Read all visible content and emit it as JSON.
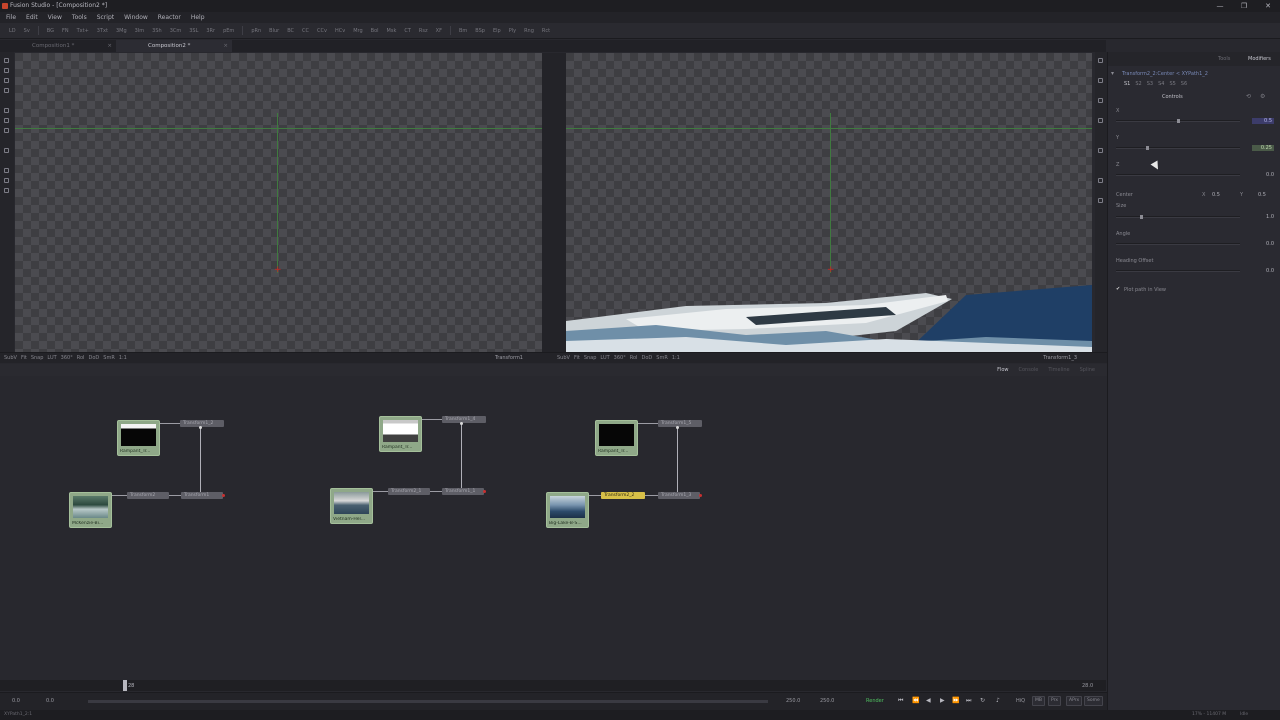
{
  "window": {
    "title": "Fusion Studio - [Composition2 *]",
    "controls": [
      "—",
      "❐",
      "✕"
    ]
  },
  "menu": [
    "File",
    "Edit",
    "View",
    "Tools",
    "Script",
    "Window",
    "Reactor",
    "Help"
  ],
  "toolbar": [
    "LD",
    "Sv",
    "BG",
    "FN",
    "Txt+",
    "3Txt",
    "3Mg",
    "3Im",
    "3Sh",
    "3Cm",
    "3SL",
    "3Rr",
    "pEm",
    "pRn",
    "Blur",
    "BC",
    "CC",
    "CCv",
    "HCv",
    "Mrg",
    "Bol",
    "Msk",
    "CT",
    "Rsz",
    "XF",
    "Bm",
    "BSp",
    "Elp",
    "Ply",
    "Rng",
    "Rct"
  ],
  "doc_tabs": [
    {
      "label": "Composition1 *",
      "active": false
    },
    {
      "label": "Composition2 *",
      "active": true
    }
  ],
  "viewers": {
    "left": {
      "bar": [
        "SubV",
        "Fit",
        "Snap",
        "LUT",
        "360°",
        "RoI",
        "DoD",
        "SmR",
        "1:1"
      ],
      "name": "Transform1"
    },
    "right": {
      "bar": [
        "SubV",
        "Fit",
        "Snap",
        "LUT",
        "360°",
        "RoI",
        "DoD",
        "SmR",
        "1:1"
      ],
      "name": "Transform1_3"
    }
  },
  "flow_tabs": [
    {
      "label": "Flow",
      "active": true
    },
    {
      "label": "Console",
      "active": false
    },
    {
      "label": "Timeline",
      "active": false
    },
    {
      "label": "Spline",
      "active": false
    }
  ],
  "flow": {
    "groups": [
      {
        "mask_label": "Rampant_Tr...",
        "loader_label": "McKenzie-Bi...",
        "t_top": "Transform1_2",
        "t_mid": "Transform2",
        "t_right": "Transform1"
      },
      {
        "mask_label": "Rampant_Tr...",
        "loader_label": "Vietnam-Hel...",
        "t_top": "Transform1_4",
        "t_mid": "Transform2_1",
        "t_right": "Transform1_1"
      },
      {
        "mask_label": "Rampant_Tr...",
        "loader_label": "Big-Lake-B-S...",
        "t_top": "Transform1_5",
        "t_mid": "Transform2_2",
        "t_right": "Transform1_3"
      }
    ]
  },
  "inspector": {
    "tabs": {
      "tools": "Tools",
      "modifiers": "Modifiers"
    },
    "header": "Transform2_2:Center < XYPath1_2",
    "subtabs": [
      "S1",
      "S2",
      "S3",
      "S4",
      "S5",
      "S6"
    ],
    "section": "Controls",
    "x_label": "X",
    "x_value": "0.5",
    "y_label": "Y",
    "y_value": "0.25",
    "z_label": "Z",
    "z_value": "0.0",
    "center_label": "Center",
    "center_x_label": "X",
    "center_x": "0.5",
    "center_y_label": "Y",
    "center_y": "0.5",
    "size_label": "Size",
    "size_value": "1.0",
    "angle_label": "Angle",
    "angle_value": "0.0",
    "heading_label": "Heading Offset",
    "heading_value": "0.0",
    "plot_label": "Plot path in View",
    "plot_checked": true,
    "progress": {
      "x_value": 0.5,
      "y_value": 0.25,
      "z_value": 0.0,
      "size": 1.0
    }
  },
  "timeline": {
    "ticks": [
      "28",
      "28.0"
    ],
    "playhead": "28"
  },
  "transport": {
    "start": "0.0",
    "current": "0.0",
    "render_end": "250.0",
    "end": "250.0",
    "render": "Render",
    "hiq": "HiQ",
    "mb": "MB",
    "prx": "Prx",
    "aprx": "APrx",
    "some": "Some"
  },
  "status": {
    "left": "XYPath1_2:1",
    "right": "17% - 11407 M",
    "state": "Idle"
  },
  "colors": {
    "accent_green": "#4fc060",
    "selected_node": "#d8c048",
    "guide": "#3f7a3f"
  }
}
